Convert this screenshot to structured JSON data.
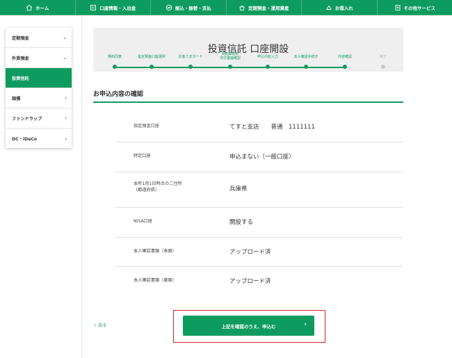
{
  "topnav": {
    "items": [
      {
        "label": "ホーム",
        "icon": "home-icon"
      },
      {
        "label": "口座情報・入出金",
        "icon": "passbook-icon"
      },
      {
        "label": "振込・振替・支払",
        "icon": "transfer-icon"
      },
      {
        "label": "定期預金・運用資産",
        "icon": "savings-pot-icon"
      },
      {
        "label": "お借入れ",
        "icon": "loan-icon"
      },
      {
        "label": "その他サービス",
        "icon": "document-icon"
      }
    ]
  },
  "sidebar": {
    "items": [
      {
        "label": "定期預金",
        "chevron": "⌄"
      },
      {
        "label": "外貨預金",
        "chevron": "⌄"
      },
      {
        "label": "投資信託",
        "chevron": ""
      },
      {
        "label": "国債",
        "chevron": "›"
      },
      {
        "label": "ファンドラップ",
        "chevron": "›"
      },
      {
        "label": "DC・iDeCo",
        "chevron": "›"
      }
    ],
    "active_index": 2
  },
  "page": {
    "title": "投資信託 口座開設"
  },
  "steps": [
    {
      "label": "規約同意"
    },
    {
      "label": "指定預金口座選択"
    },
    {
      "label": "お客さまカード"
    },
    {
      "label": "契約締結前\n交付書面確認"
    },
    {
      "label": "申込内容入力"
    },
    {
      "label": "本人確認手続き"
    },
    {
      "label": "内容確認"
    },
    {
      "label": "完了"
    }
  ],
  "current_step": 7,
  "section": {
    "title": "お申込内容の確認"
  },
  "rows": [
    {
      "label": "指定預金口座",
      "value": "てすと支店　　普通　1111111"
    },
    {
      "label": "特定口座",
      "value": "申込まない（一般口座）"
    },
    {
      "label": "本年1月1日時点のご住所\n（都道府県）",
      "value": "兵庫県"
    },
    {
      "label": "NISA口座",
      "value": "開設する"
    },
    {
      "label": "本人確認書類（表面）",
      "value": "アップロード済"
    },
    {
      "label": "本人確認書類（裏面）",
      "value": "アップロード済"
    }
  ],
  "actions": {
    "back_label": "戻る",
    "submit_label": "上記を確認のうえ、申込む",
    "submit_arrow": "›"
  },
  "colors": {
    "brand_green": "#0e9b5f",
    "highlight_red": "#d61f26"
  }
}
